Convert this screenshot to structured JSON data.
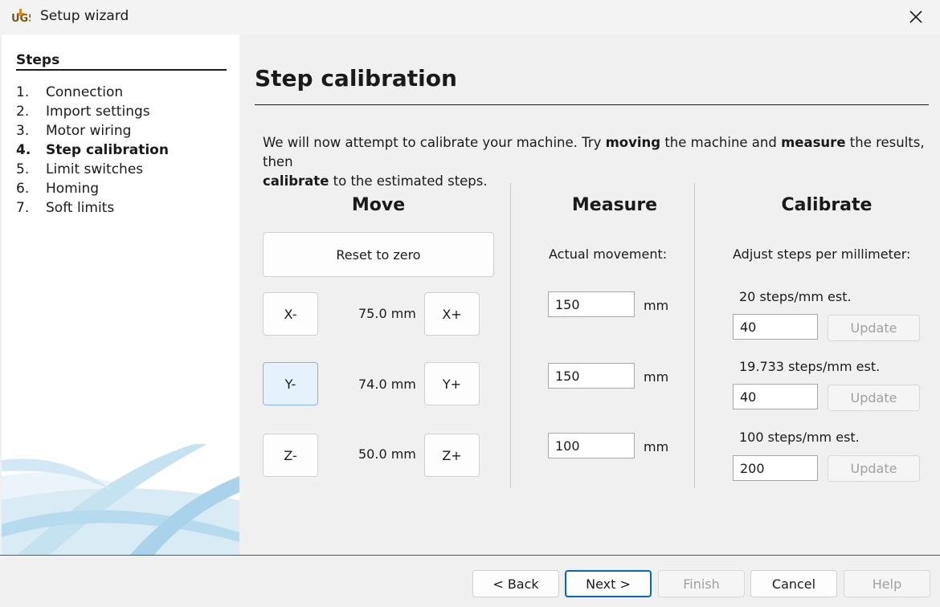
{
  "window": {
    "title": "Setup wizard",
    "app_icon": "ugs-logo-icon",
    "close_icon": "close-icon"
  },
  "sidebar": {
    "title": "Steps",
    "items": [
      {
        "num": "1.",
        "label": "Connection"
      },
      {
        "num": "2.",
        "label": "Import settings"
      },
      {
        "num": "3.",
        "label": "Motor wiring"
      },
      {
        "num": "4.",
        "label": "Step calibration"
      },
      {
        "num": "5.",
        "label": "Limit switches"
      },
      {
        "num": "6.",
        "label": "Homing"
      },
      {
        "num": "7.",
        "label": "Soft limits"
      }
    ],
    "active_index": 3
  },
  "main": {
    "title": "Step calibration",
    "intro": {
      "t1": "We will now attempt to calibrate your machine. Try ",
      "b1": "moving",
      "t2": " the machine and ",
      "b2": "measure",
      "t3": " the results, then",
      "b3": "calibrate",
      "t4": " to the estimated steps."
    },
    "move": {
      "heading": "Move",
      "reset_label": "Reset to zero",
      "axes": [
        {
          "minus": "X-",
          "value": "75.0 mm",
          "plus": "X+"
        },
        {
          "minus": "Y-",
          "value": "74.0 mm",
          "plus": "Y+"
        },
        {
          "minus": "Z-",
          "value": "50.0 mm",
          "plus": "Z+"
        }
      ]
    },
    "measure": {
      "heading": "Measure",
      "label": "Actual movement:",
      "unit": "mm",
      "values": [
        "150",
        "150",
        "100"
      ]
    },
    "calibrate": {
      "heading": "Calibrate",
      "label": "Adjust steps per millimeter:",
      "update_label": "Update",
      "rows": [
        {
          "estimate": "20 steps/mm est.",
          "value": "40"
        },
        {
          "estimate": "19.733 steps/mm est.",
          "value": "40"
        },
        {
          "estimate": "100 steps/mm est.",
          "value": "200"
        }
      ]
    }
  },
  "footer": {
    "back": "< Back",
    "next": "Next >",
    "finish": "Finish",
    "cancel": "Cancel",
    "help": "Help"
  },
  "colors": {
    "accent": "#0067c0",
    "hover_bg": "#e5f1fb",
    "disabled_text": "#a0a0a0"
  }
}
